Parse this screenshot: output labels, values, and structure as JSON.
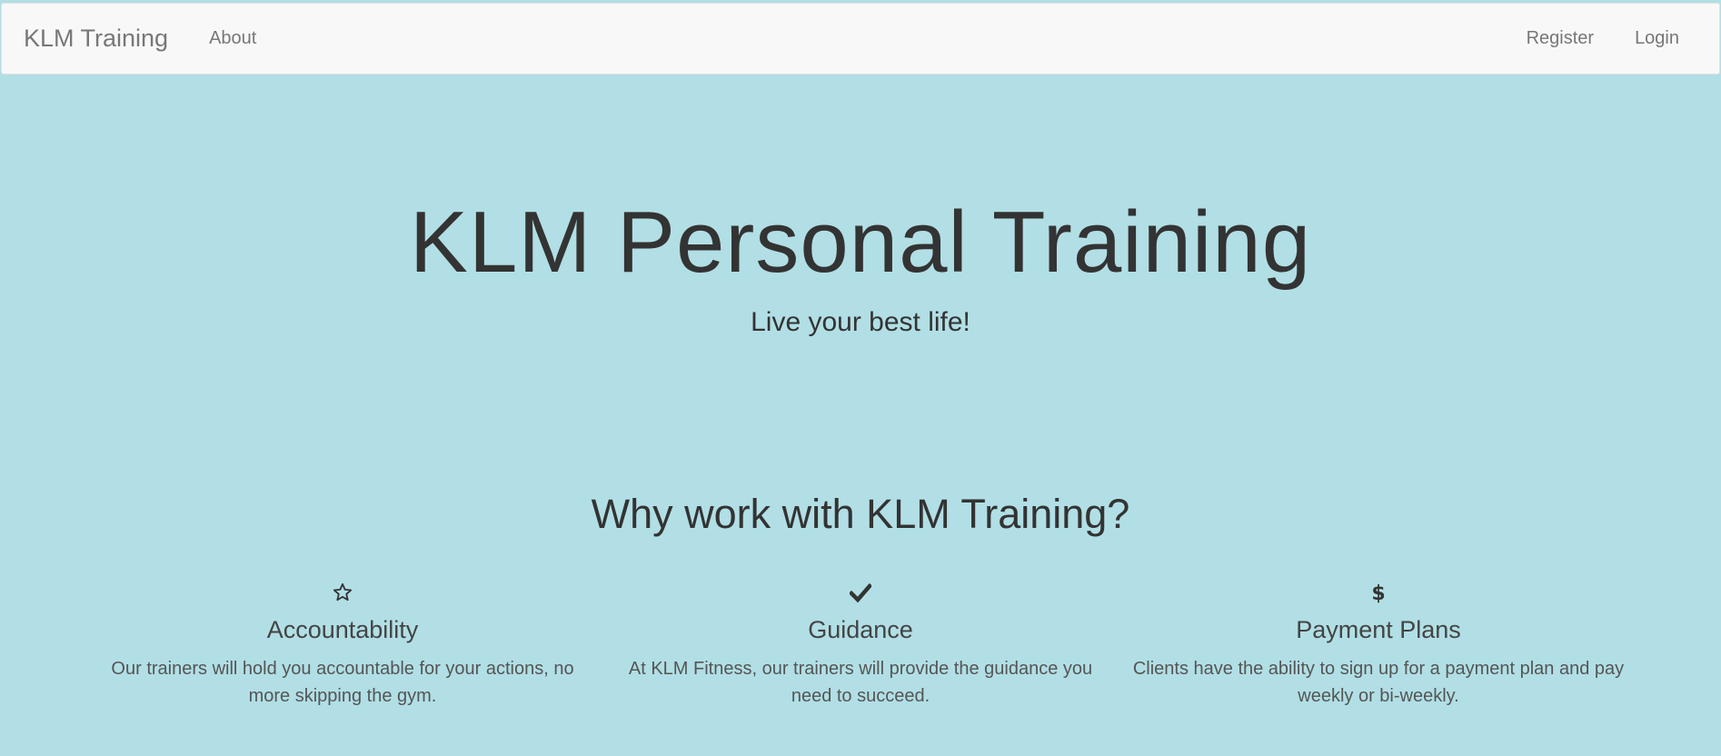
{
  "navbar": {
    "brand": "KLM Training",
    "links_left": [
      {
        "label": "About"
      }
    ],
    "links_right": [
      {
        "label": "Register"
      },
      {
        "label": "Login"
      }
    ]
  },
  "hero": {
    "title": "KLM Personal Training",
    "subtitle": "Live your best life!"
  },
  "why": {
    "title": "Why work with KLM Training?"
  },
  "features": [
    {
      "icon": "star-icon",
      "title": "Accountability",
      "text": "Our trainers will hold you accountable for your actions, no more skipping the gym."
    },
    {
      "icon": "checkmark-icon",
      "title": "Guidance",
      "text": "At KLM Fitness, our trainers will provide the guidance you need to succeed."
    },
    {
      "icon": "dollar-icon",
      "title": "Payment Plans",
      "text": "Clients have the ability to sign up for a payment plan and pay weekly or bi-weekly."
    }
  ],
  "colors": {
    "background": "#b1dfe5",
    "navbar": "#f8f8f8",
    "text": "#333333",
    "nav_text": "#777777"
  }
}
